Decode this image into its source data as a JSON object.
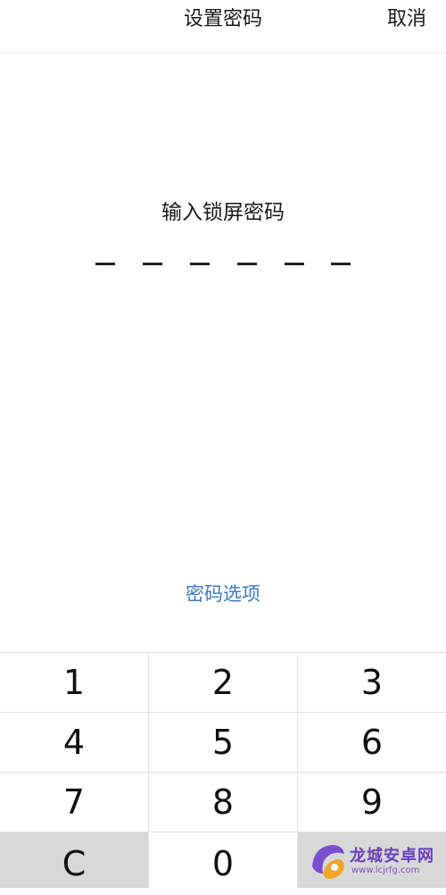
{
  "header": {
    "title": "设置密码",
    "cancel_label": "取消"
  },
  "prompt": "输入锁屏密码",
  "pin": {
    "length": 6,
    "entered": 0
  },
  "options_link": "密码选项",
  "keypad": {
    "keys": [
      "1",
      "2",
      "3",
      "4",
      "5",
      "6",
      "7",
      "8",
      "9",
      "C",
      "0",
      ""
    ]
  },
  "watermark": {
    "brand": "龙城安卓网",
    "url": "www.lcjrfg.com"
  },
  "colors": {
    "link": "#3f78c0",
    "keypad_bg": "#e2e2e2",
    "function_key_bg": "#d8d8d8",
    "watermark": "#6a3fb8"
  }
}
